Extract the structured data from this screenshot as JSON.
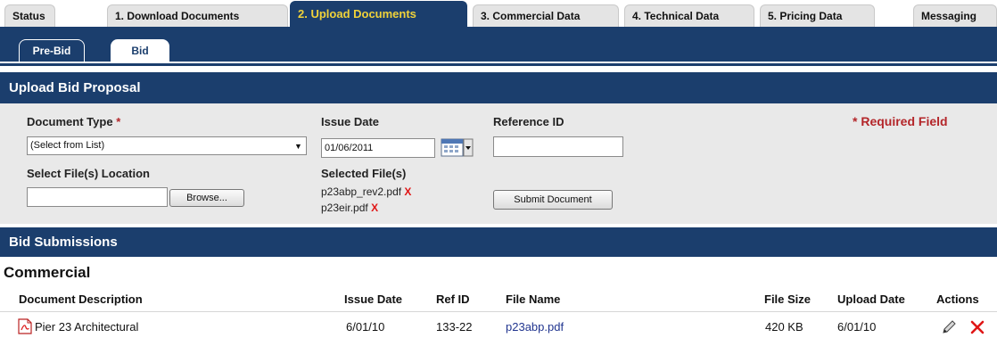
{
  "tabs": [
    {
      "label": "Status"
    },
    {
      "label": "1. Download Documents"
    },
    {
      "label": "2. Upload Documents",
      "active": true
    },
    {
      "label": "3. Commercial Data"
    },
    {
      "label": "4. Technical Data"
    },
    {
      "label": "5. Pricing Data"
    },
    {
      "label": "Messaging"
    }
  ],
  "subtabs": [
    {
      "label": "Pre-Bid"
    },
    {
      "label": "Bid",
      "active": true
    }
  ],
  "upload": {
    "header": "Upload Bid Proposal",
    "document_type_label": "Document Type",
    "required_marker": "*",
    "document_type_value": "(Select from List)",
    "issue_date_label": "Issue Date",
    "issue_date_value": "01/06/2011",
    "reference_id_label": "Reference ID",
    "reference_id_value": "",
    "required_field_text": "* Required Field",
    "file_location_label": "Select File(s) Location",
    "file_location_value": "",
    "browse_label": "Browse...",
    "selected_files_label": "Selected File(s)",
    "selected_files": [
      "p23abp_rev2.pdf",
      "p23eir.pdf"
    ],
    "remove_mark": "X",
    "submit_label": "Submit Document"
  },
  "submissions": {
    "header": "Bid Submissions",
    "section_title": "Commercial",
    "columns": [
      "Document Description",
      "Issue Date",
      "Ref ID",
      "File Name",
      "File Size",
      "Upload Date",
      "Actions"
    ],
    "rows": [
      {
        "description": "Pier 23 Architectural",
        "issue_date": "6/01/10",
        "ref_id": "133-22",
        "file_name": "p23abp.pdf",
        "file_size": "420 KB",
        "upload_date": "6/01/10"
      }
    ]
  },
  "icons": {
    "pdf": "pdf-file-icon",
    "edit": "pencil-edit-icon",
    "delete": "delete-x-icon",
    "calendar": "calendar-icon"
  },
  "colors": {
    "navy": "#1b3e6d",
    "active_tab_text": "#f0d23a",
    "required": "#b4262a",
    "delete": "#e01616",
    "link": "#21358f"
  }
}
